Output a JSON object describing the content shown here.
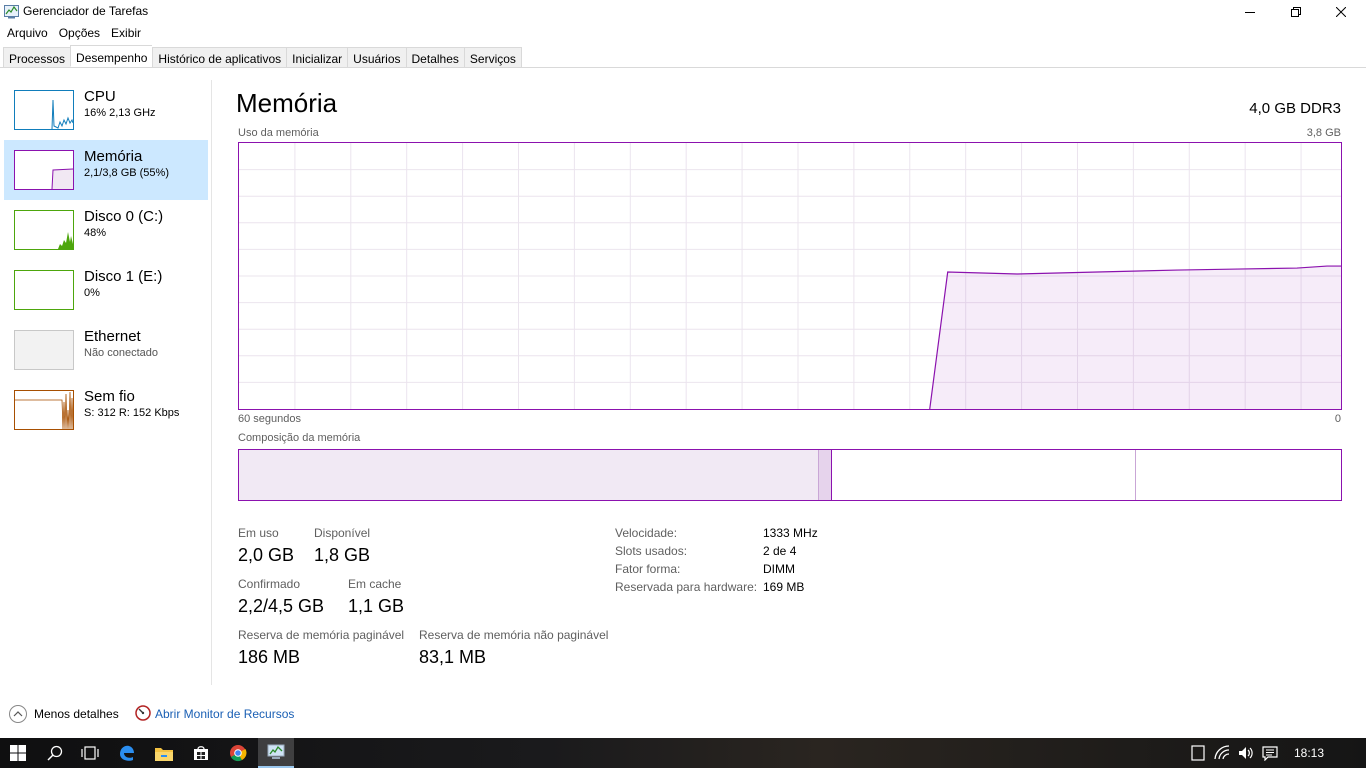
{
  "window": {
    "title": "Gerenciador de Tarefas"
  },
  "menu": [
    "Arquivo",
    "Opções",
    "Exibir"
  ],
  "tabs": [
    "Processos",
    "Desempenho",
    "Histórico de aplicativos",
    "Inicializar",
    "Usuários",
    "Detalhes",
    "Serviços"
  ],
  "active_tab": "Desempenho",
  "sidebar": {
    "items": [
      {
        "name": "CPU",
        "sub": "16% 2,13 GHz",
        "color": "#117dbb"
      },
      {
        "name": "Memória",
        "sub": "2,1/3,8 GB (55%)",
        "color": "#8b12ae"
      },
      {
        "name": "Disco 0 (C:)",
        "sub": "48%",
        "color": "#4da60c"
      },
      {
        "name": "Disco 1 (E:)",
        "sub": "0%",
        "color": "#4da60c"
      },
      {
        "name": "Ethernet",
        "sub": "Não conectado",
        "color": "#a0a0a0"
      },
      {
        "name": "Sem fio",
        "sub": "S: 312 R: 152 Kbps",
        "color": "#a74f01"
      }
    ]
  },
  "main": {
    "title": "Memória",
    "spec": "4,0 GB DDR3",
    "usage_label": "Uso da memória",
    "usage_max": "3,8 GB",
    "time_label": "60 segundos",
    "time_end": "0",
    "composition_label": "Composição da memória",
    "graph_color": "#8b12ae"
  },
  "stats": {
    "in_use_label": "Em uso",
    "in_use": "2,0 GB",
    "available_label": "Disponível",
    "available": "1,8 GB",
    "committed_label": "Confirmado",
    "committed": "2,2/4,5 GB",
    "cached_label": "Em cache",
    "cached": "1,1 GB",
    "paged_label": "Reserva de memória paginável",
    "paged": "186 MB",
    "nonpaged_label": "Reserva de memória não paginável",
    "nonpaged": "83,1 MB"
  },
  "specs": {
    "speed_label": "Velocidade:",
    "speed": "1333 MHz",
    "slots_label": "Slots usados:",
    "slots": "2 de 4",
    "form_label": "Fator forma:",
    "form": "DIMM",
    "reserved_label": "Reservada para hardware:",
    "reserved": "169 MB"
  },
  "footer": {
    "fewer": "Menos detalhes",
    "resmon": "Abrir Monitor de Recursos"
  },
  "taskbar": {
    "clock": "18:13"
  }
}
